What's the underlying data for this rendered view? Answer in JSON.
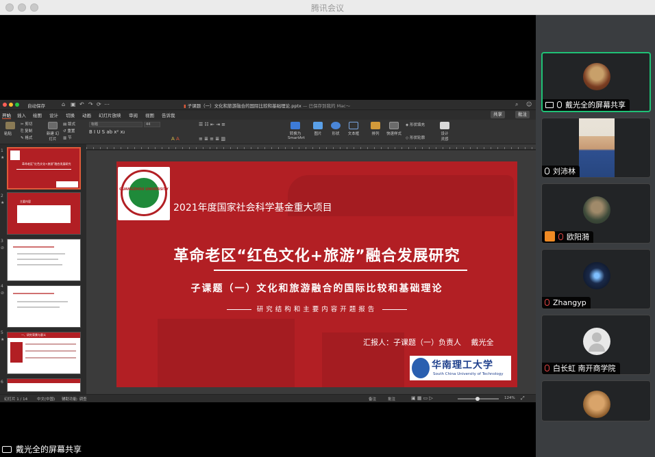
{
  "window": {
    "title": "腾讯会议"
  },
  "ppt": {
    "autosave": "自动保存",
    "doc_title": "子课题（一）文化和旅游融合的国际比较和基础理论.pptx",
    "doc_status": "— 已保存到我的 Mac～",
    "tabs": [
      "开始",
      "插入",
      "绘图",
      "设计",
      "切换",
      "动画",
      "幻灯片放映",
      "审阅",
      "视图",
      "告诉我"
    ],
    "share_btn": "共享",
    "comment_btn": "批注",
    "ribbon": {
      "paste": "粘贴",
      "cut": "剪切",
      "copy": "复制",
      "format": "格式",
      "new_slide": "新建\n幻灯片",
      "layout": "版式",
      "reset": "重置",
      "section": "节",
      "font_placeholder": "标题",
      "font_size": "44",
      "convert": "转换为\nSmartArt",
      "picture": "图片",
      "shape": "形状",
      "textbox": "文本框",
      "arrange": "排列",
      "quick_styles": "快速样式",
      "shape_fill": "形状填充",
      "shape_outline": "形状轮廓",
      "designer": "设计\n灵感"
    },
    "slide_numbers": [
      "1",
      "2",
      "3",
      "4",
      "5",
      "6"
    ],
    "slide": {
      "project": "2021年度国家社会科学基金重大项目",
      "title": "革命老区“红色文化+旅游”融合发展研究",
      "subtitle": "子课题（一）文化和旅游融合的国际比较和基础理论",
      "subtitle2": "研究结构和主要内容开题报告",
      "reporter": "汇报人：子课题（一）负责人　 戴光全",
      "left_logo_text": "GUANGZHOU UNIVERSITY",
      "scut_cn": "华南理工大学",
      "scut_en": "South China University of Technology",
      "thumb1_title": "革命老区“红色文化+旅游”融合发展研究",
      "thumb2_title": "主要内容",
      "thumb5_title": "一、研究背景与意义"
    },
    "status": {
      "slide_counter": "幻灯片 1 / 14",
      "language": "中文(中国)",
      "accessibility": "辅助功能: 调查",
      "notes": "备注",
      "comments": "批注",
      "zoom": "124%"
    }
  },
  "share_label": "戴光全的屏幕共享",
  "participants": [
    {
      "name": "戴光全的屏幕共享",
      "mic": "on",
      "screen": true,
      "active": true
    },
    {
      "name": "刘沛林",
      "mic": "on",
      "video": true
    },
    {
      "name": "欧阳漪",
      "mic": "muted",
      "badge": true
    },
    {
      "name": "Zhangyp",
      "mic": "muted"
    },
    {
      "name": "白长虹 南开商学院",
      "mic": "muted"
    },
    {
      "name": "",
      "mic": "none"
    }
  ],
  "colors": {
    "slide_red": "#b21f24",
    "active_border": "#1fc276",
    "muted_red": "#e64545",
    "scut_blue": "#1e3f8c"
  }
}
